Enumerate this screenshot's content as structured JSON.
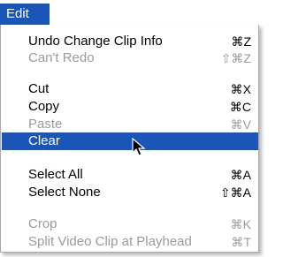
{
  "menu": {
    "title": "Edit",
    "items": [
      {
        "label": "Undo Change Clip Info",
        "shortcut": "⌘Z",
        "enabled": true
      },
      {
        "label": "Can't Redo",
        "shortcut": "⇧⌘Z",
        "enabled": false
      },
      {
        "label": "Cut",
        "shortcut": "⌘X",
        "enabled": true
      },
      {
        "label": "Copy",
        "shortcut": "⌘C",
        "enabled": true
      },
      {
        "label": "Paste",
        "shortcut": "⌘V",
        "enabled": false
      },
      {
        "label": "Clear",
        "shortcut": "",
        "enabled": true,
        "selected": true
      },
      {
        "label": "Select All",
        "shortcut": "⌘A",
        "enabled": true
      },
      {
        "label": "Select None",
        "shortcut": "⇧⌘A",
        "enabled": true
      },
      {
        "label": "Crop",
        "shortcut": "⌘K",
        "enabled": false
      },
      {
        "label": "Split Video Clip at Playhead",
        "shortcut": "⌘T",
        "enabled": false
      }
    ]
  },
  "colors": {
    "highlight": "#1a55b8",
    "text": "#000000",
    "disabled_text": "#9a9a9a",
    "menu_background": "#ffffff"
  },
  "icons": {
    "cursor": "arrow-pointer-icon"
  }
}
